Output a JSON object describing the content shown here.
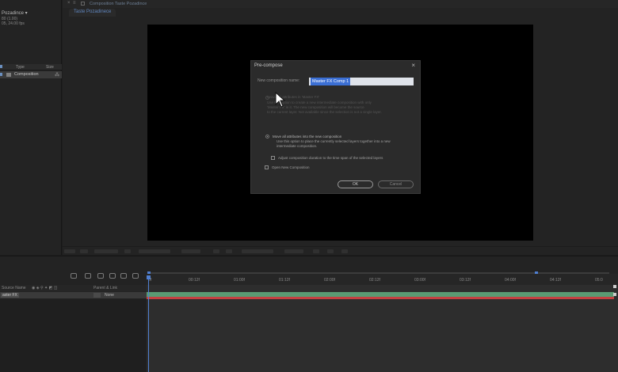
{
  "project": {
    "name": "Pozadince ▾",
    "info_lines": [
      "80 (1.00)",
      "05, 24.00 fps"
    ],
    "columns": {
      "name": "Type",
      "size": "Size"
    },
    "item_label": "Composition"
  },
  "composition": {
    "tab_text": "Composition  Taste Pozadince",
    "subtab": "Taste Pozadinece"
  },
  "dialog": {
    "title": "Pre-compose",
    "close_glyph": "×",
    "name_label": "New composition name:",
    "name_value": "Master FX Comp 1",
    "option_leave_lines": [
      "Leave all attributes in 'Master FX'",
      "Use this option to create a new intermediate composition with only",
      "'Master FX' in it. The new composition will become the source",
      "to the current layer. Not available since the selection is not a single layer."
    ],
    "option_move_title": "Move all attributes into the new composition",
    "option_move_desc": [
      "Use this option to place the currently selected layers together into a new",
      "intermediate composition."
    ],
    "adjust_label": "Adjust composition duration to the time span of the selected layers",
    "open_label": "Open New Composition",
    "ok_label": "OK",
    "cancel_label": "Cancel"
  },
  "timeline": {
    "col_source": "Source Name",
    "col_parent": "Parent & Link",
    "layer_name": "aster FX",
    "parent_value": "None",
    "ticks": [
      "0f",
      "00:12f",
      "01:00f",
      "01:12f",
      "02:00f",
      "02:12f",
      "03:00f",
      "03:12f",
      "04:00f",
      "04:12f",
      "05:0"
    ]
  },
  "colors": {
    "accent": "#4f7fd1",
    "layer_green": "#5a9b73",
    "layer_red": "#c44141",
    "selection": "#3b6fd4"
  }
}
